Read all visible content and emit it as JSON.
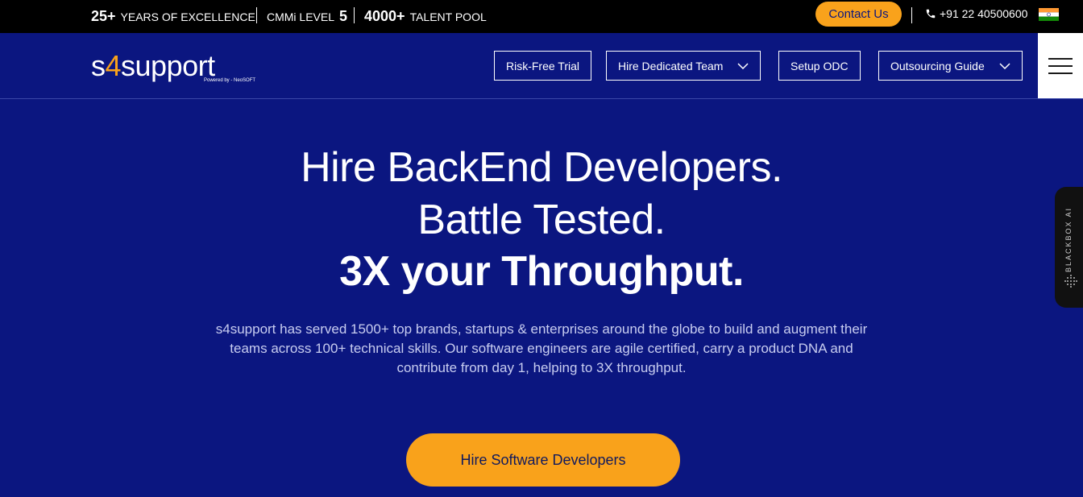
{
  "topbar": {
    "stats": [
      {
        "num": "25+",
        "label": "YEARS OF EXCELLENCE"
      },
      {
        "label": "CMMi LEVEL",
        "num": "5"
      },
      {
        "num": "4000+",
        "label": "TALENT POOL"
      }
    ],
    "contact_label": "Contact Us",
    "phone": "+91 22 40500600",
    "flag_icon": "india-flag-icon",
    "phone_icon": "phone-icon"
  },
  "navbar": {
    "logo_s": "s",
    "logo_four": "4",
    "logo_rest": "support",
    "logo_sub": "Powered by - NeoSOFT",
    "items": [
      {
        "label": "Risk-Free Trial"
      },
      {
        "label": "Hire Dedicated Team"
      },
      {
        "label": "Setup ODC"
      },
      {
        "label": "Outsourcing Guide"
      }
    ]
  },
  "hero": {
    "line1": "Hire BackEnd Developers.",
    "line2": "Battle Tested.",
    "line3": "3X your Throughput.",
    "description": "s4support has served 1500+ top brands, startups & enterprises around the globe to build and augment their teams across 100+ technical skills. Our software engineers are agile certified, carry a product DNA and contribute from day 1, helping to 3X throughput.",
    "cta_label": "Hire Software Developers"
  },
  "side_widget": {
    "label": "BLACKBOX AI"
  },
  "colors": {
    "brand_blue": "#0b1680",
    "accent_orange": "#f9a21b",
    "topbar_bg": "#000000"
  }
}
